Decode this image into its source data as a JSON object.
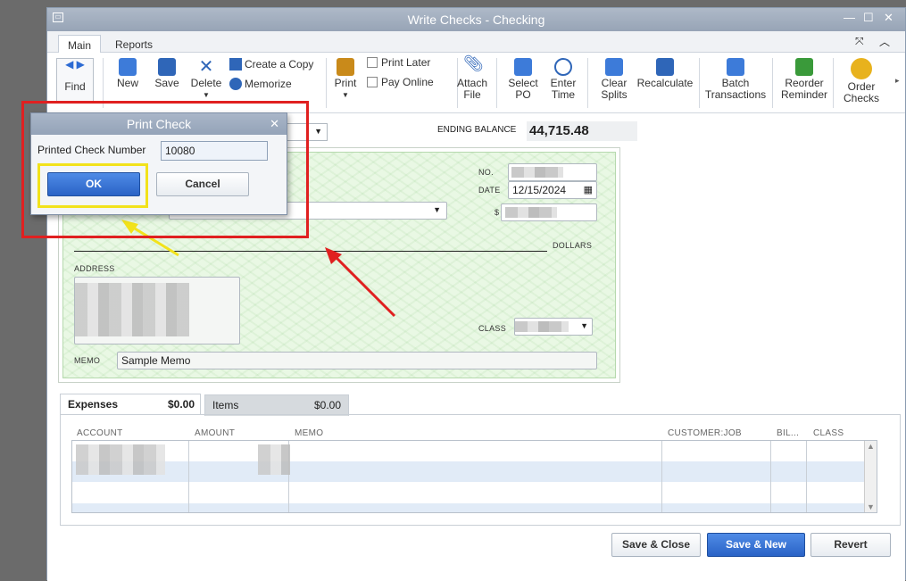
{
  "window": {
    "title": "Write Checks - Checking"
  },
  "tabs": [
    {
      "label": "Main"
    },
    {
      "label": "Reports"
    }
  ],
  "toolbar": {
    "find": "Find",
    "new": "New",
    "save": "Save",
    "delete": "Delete",
    "create_copy": "Create a Copy",
    "memorize": "Memorize",
    "print": "Print",
    "print_later": "Print Later",
    "pay_online": "Pay Online",
    "attach_l1": "Attach",
    "attach_l2": "File",
    "select_l1": "Select",
    "select_l2": "PO",
    "enter_l1": "Enter",
    "enter_l2": "Time",
    "clear_l1": "Clear",
    "clear_l2": "Splits",
    "recalculate": "Recalculate",
    "batch_l1": "Batch",
    "batch_l2": "Transactions",
    "reorder_l1": "Reorder",
    "reorder_l2": "Reminder",
    "order_l1": "Order",
    "order_l2": "Checks"
  },
  "ending_balance": {
    "label": "ENDING BALANCE",
    "value": "44,715.48"
  },
  "check": {
    "no_label": "NO.",
    "date_label": "DATE",
    "date_value": "12/15/2024",
    "amount_label": "$",
    "dollars_label": "DOLLARS",
    "address_label": "ADDRESS",
    "class_label": "CLASS",
    "memo_label": "MEMO",
    "memo_value": "Sample Memo"
  },
  "grid": {
    "tabs": [
      {
        "label": "Expenses",
        "amount": "$0.00"
      },
      {
        "label": "Items",
        "amount": "$0.00"
      }
    ],
    "columns": [
      "ACCOUNT",
      "AMOUNT",
      "MEMO",
      "CUSTOMER:JOB",
      "BIL...",
      "CLASS"
    ]
  },
  "buttons": {
    "save_close": "Save & Close",
    "save_new": "Save & New",
    "revert": "Revert"
  },
  "dialog": {
    "title": "Print Check",
    "label": "Printed Check Number",
    "value": "10080",
    "ok": "OK",
    "cancel": "Cancel"
  },
  "colors": {
    "annotation_red": "#e02020",
    "annotation_yellow": "#f2e21b",
    "check_bg": "#e9f8e4",
    "primary_button": "#2a63c6"
  }
}
